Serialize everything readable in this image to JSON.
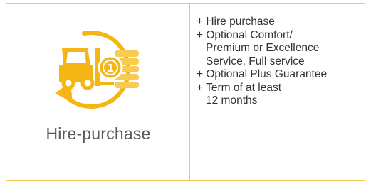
{
  "colors": {
    "accent": "#F5B614",
    "accent_light": "#F7CA52",
    "border": "#C8C8C8",
    "bottom_rule": "#F3C54A"
  },
  "left": {
    "icon": "forklift-coins-cycle-icon",
    "title": "Hire-purchase"
  },
  "right": {
    "features": [
      "+ Hire purchase",
      "+ Optional Comfort/\nPremium or Excellence\nService, Full service",
      "+ Optional Plus Guarantee",
      "+ Term of at least\n12 months"
    ]
  }
}
